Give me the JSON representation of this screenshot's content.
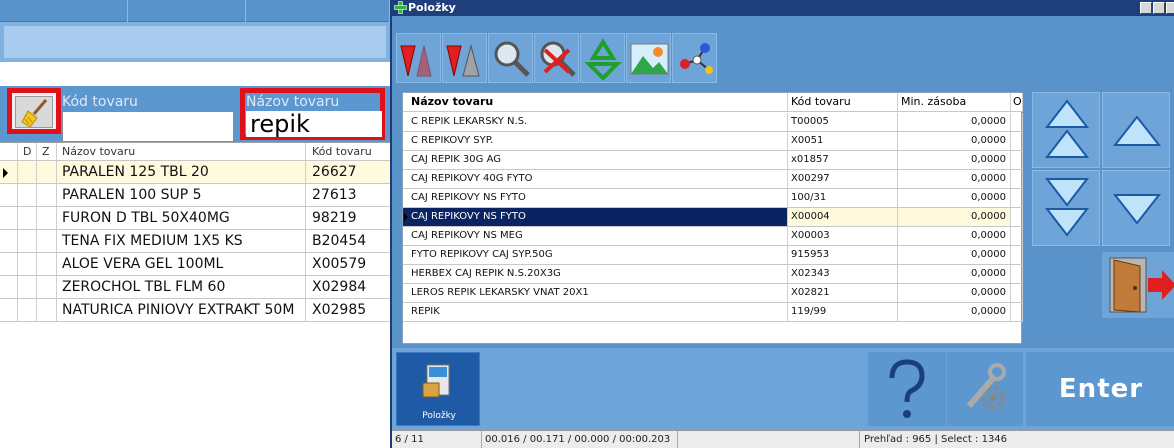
{
  "left": {
    "filters": {
      "code_label": "Kód tovaru",
      "name_label": "Názov tovaru",
      "name_value": "repik"
    },
    "grid": {
      "headers": [
        "D",
        "Z",
        "Názov tovaru",
        "Kód tovaru"
      ],
      "rows": [
        {
          "name": "PARALEN 125   TBL 20",
          "code": "26627"
        },
        {
          "name": "PARALEN 100  SUP  5",
          "code": "27613"
        },
        {
          "name": "FURON D         TBL 50X40MG",
          "code": "98219"
        },
        {
          "name": "TENA FIX MEDIUM 1X5 KS",
          "code": "B20454"
        },
        {
          "name": " ALOE VERA GEL 100ML",
          "code": "X00579"
        },
        {
          "name": "ZEROCHOL TBL FLM 60",
          "code": "X02984"
        },
        {
          "name": "NATURICA PINIOVY EXTRAKT 50M",
          "code": "X02985"
        }
      ]
    }
  },
  "window": {
    "title": "Položky"
  },
  "grid": {
    "headers": [
      "Názov tovaru",
      "Kód tovaru",
      "Min. zásoba",
      "O"
    ],
    "rows": [
      {
        "name": "C REPIK LEKARSKY N.S.",
        "code": "T00005",
        "min": "0,0000"
      },
      {
        "name": "C REPIKOVY SYP.",
        "code": "X0051",
        "min": "0,0000"
      },
      {
        "name": "CAJ REPIK 30G AG",
        "code": "x01857",
        "min": "0,0000"
      },
      {
        "name": "CAJ REPIKOVY 40G      FYTO",
        "code": "X00297",
        "min": "0,0000"
      },
      {
        "name": "CAJ REPIKOVY NS       FYTO",
        "code": "100/31",
        "min": "0,0000"
      },
      {
        "name": "CAJ REPIKOVY NS  FYTO",
        "code": "X00004",
        "min": "0,0000"
      },
      {
        "name": "CAJ REPIKOVY NS  MEG",
        "code": "X00003",
        "min": "0,0000"
      },
      {
        "name": "FYTO REPIKOVY CAJ SYP.50G",
        "code": "915953",
        "min": "0,0000"
      },
      {
        "name": "HERBEX CAJ REPIK N.S.20X3G",
        "code": "X02343",
        "min": "0,0000"
      },
      {
        "name": "LEROS REPIK LEKARSKY VNAT 20X1",
        "code": "X02821",
        "min": "0,0000"
      },
      {
        "name": "REPIK",
        "code": "119/99",
        "min": "0,0000"
      }
    ]
  },
  "bottom": {
    "polozky_label": "Položky",
    "enter_label": "Enter"
  },
  "status": {
    "position": "6 / 11",
    "timing": "00.016 / 00.171 / 00.000 / 00:00.203",
    "info": "Prehľad : 965 | Select : 1346"
  },
  "colors": {
    "panel_blue": "#5a93c9",
    "selection_navy": "#0a2463",
    "highlight_red": "#e0101b",
    "title_bar": "#1e3f7c"
  }
}
